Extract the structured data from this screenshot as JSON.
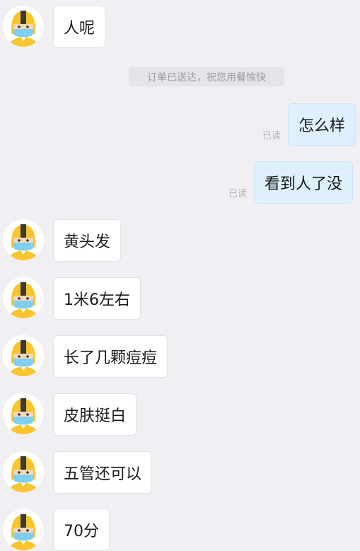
{
  "system_notice": "订单已送达，祝您用餐愉快",
  "read_label": "已读",
  "avatar_icon": "courier-avatar-icon",
  "colors": {
    "background": "#f2eff4",
    "incoming_bubble": "#ffffff",
    "outgoing_bubble": "#dff0fd",
    "helmet_yellow": "#f8c62c",
    "mask_blue": "#7ecff0"
  },
  "messages": [
    {
      "side": "in",
      "text": "人呢"
    },
    {
      "side": "out",
      "text": "怎么样",
      "status": "已读"
    },
    {
      "side": "out",
      "text": "看到人了没",
      "status": "已读"
    },
    {
      "side": "in",
      "text": "黄头发"
    },
    {
      "side": "in",
      "text": "1米6左右"
    },
    {
      "side": "in",
      "text": "长了几颗痘痘"
    },
    {
      "side": "in",
      "text": "皮肤挺白"
    },
    {
      "side": "in",
      "text": "五管还可以"
    },
    {
      "side": "in",
      "text": "70分"
    }
  ]
}
